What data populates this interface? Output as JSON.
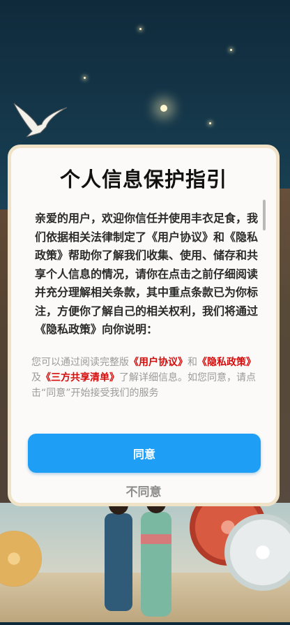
{
  "dialog": {
    "title": "个人信息保护指引",
    "body": "亲爱的用户，欢迎你信任并使用丰衣足食，我们依据相关法律制定了《用户协议》和《隐私政策》帮助你了解我们收集、使用、储存和共享个人信息的情况，请你在点击之前仔细阅读并充分理解相关条款，其中重点条款已为你标注，方便你了解自己的相关权利，我们将通过《隐私政策》向你说明：",
    "secondary": {
      "prefix": "您可以通过阅读完整版",
      "link_user_agreement": "《用户协议》",
      "and": "和",
      "link_privacy_policy": "《隐私政策》",
      "and2": "及",
      "link_third_party": "《三方共享清单》",
      "suffix": "了解详细信息。如您同意，请点击“同意”开始接受我们的服务"
    },
    "agree_label": "同意",
    "disagree_label": "不同意"
  },
  "colors": {
    "accent": "#1e9ff5",
    "link": "#d60b0b",
    "dialog_border": "#f0e2c7"
  }
}
